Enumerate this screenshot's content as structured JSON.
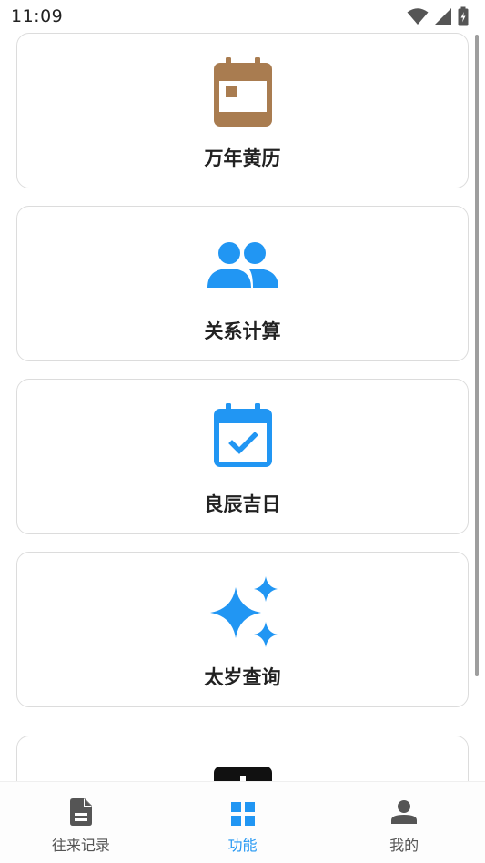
{
  "status_bar": {
    "time": "11:09"
  },
  "cards": [
    {
      "label": "万年黄历",
      "icon": "calendar-icon",
      "color": "#a97c50"
    },
    {
      "label": "关系计算",
      "icon": "people-icon",
      "color": "#2196f3"
    },
    {
      "label": "良辰吉日",
      "icon": "calendar-check-icon",
      "color": "#2196f3"
    },
    {
      "label": "太岁查询",
      "icon": "sparkle-icon",
      "color": "#2196f3"
    },
    {
      "label": "",
      "icon": "dark-app-icon",
      "color": "#111111"
    }
  ],
  "bottom_nav": {
    "items": [
      {
        "label": "往来记录",
        "icon": "document-icon",
        "active": false
      },
      {
        "label": "功能",
        "icon": "grid-icon",
        "active": true
      },
      {
        "label": "我的",
        "icon": "person-icon",
        "active": false
      }
    ],
    "active_color": "#2196f3",
    "inactive_color": "#555555"
  }
}
